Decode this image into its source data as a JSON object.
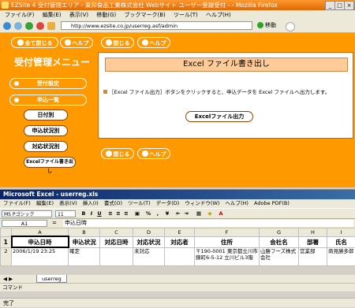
{
  "firefox": {
    "title": "EZSite 4 受付管理エリア - 東邦食品工業株式会社 Webサイト ユーザー登録受付 - - Mozilla Firefox",
    "menu": [
      "ファイル(F)",
      "編集(E)",
      "表示(V)",
      "移動(G)",
      "ブックマーク(B)",
      "ツール(T)",
      "ヘルプ(H)"
    ],
    "url": "http://www.ezsite.co.jp/userreg.asf/admin",
    "go_label": "移動",
    "status": "完了"
  },
  "page": {
    "top_actions": {
      "all_close": "全て閉じる",
      "help_left": "ヘルプ",
      "close": "閉じる",
      "help_right": "ヘルプ"
    },
    "bottom_actions": {
      "close": "閉じる",
      "help": "ヘルプ"
    },
    "sidebar": {
      "heading": "受付管理メニュー",
      "items": [
        {
          "label": "受付設定"
        },
        {
          "label": "申込一覧"
        }
      ],
      "subitems": [
        "日付別",
        "申込状況別",
        "対応状況別",
        "Excelファイル書き出し"
      ]
    },
    "panel": {
      "title": "Excel ファイル書き出し",
      "description": "［Excel ファイル出力］ボタンをクリックすると、申込データを Excel ファイルへ出力します。",
      "button": "Excelファイル出力"
    }
  },
  "excel": {
    "title": "Microsoft Excel - userreg.xls",
    "menu": [
      "ファイル(F)",
      "編集(E)",
      "表示(V)",
      "挿入(I)",
      "書式(O)",
      "ツール(T)",
      "データ(D)",
      "ウィンドウ(W)",
      "ヘルプ(H)",
      "Adobe PDF(B)"
    ],
    "font": "MS Pゴシック",
    "font_size": "11",
    "name_box": "A1",
    "formula_content": "申込日時",
    "columns": [
      "A",
      "B",
      "C",
      "D",
      "E",
      "F",
      "G",
      "H",
      "I"
    ],
    "rows": [
      {
        "num": "1",
        "cells": [
          "申込日時",
          "申込状況",
          "対応日時",
          "対応状況",
          "対応者",
          "住所",
          "会社名",
          "部署",
          "氏名"
        ]
      },
      {
        "num": "2",
        "cells": [
          "2006/1/19 23:25",
          "確定",
          "",
          "未対応",
          "",
          "〒190-0001 東京都立川市錦町6-5-12 立川ビル3階",
          "山勝フーズ株式会社",
          "営業部",
          "商見勝多郎"
        ]
      }
    ],
    "sheet_tab": "userreg",
    "status": "コマンド"
  }
}
